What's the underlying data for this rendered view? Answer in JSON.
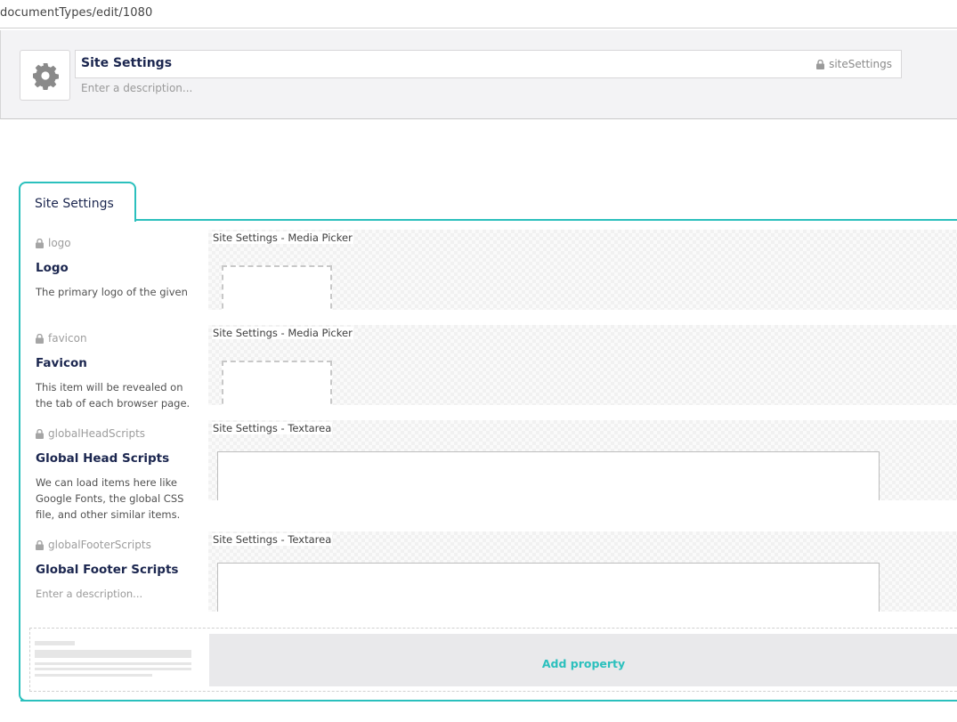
{
  "url": "documentTypes/edit/1080",
  "header": {
    "icon": "gear-icon",
    "name": "Site Settings",
    "alias": "siteSettings",
    "description_placeholder": "Enter a description..."
  },
  "group": {
    "tab_label": "Site Settings"
  },
  "properties": [
    {
      "alias": "logo",
      "label": "Logo",
      "description": "The primary logo of the given site.",
      "editor": "Site Settings - Media Picker",
      "editor_kind": "media"
    },
    {
      "alias": "favicon",
      "label": "Favicon",
      "description": "This item will be revealed on the tab of each browser page.",
      "editor": "Site Settings - Media Picker",
      "editor_kind": "media"
    },
    {
      "alias": "globalHeadScripts",
      "label": "Global Head Scripts",
      "description": "We can load items here like Google Fonts, the global CSS file, and other similar items.",
      "editor": "Site Settings - Textarea",
      "editor_kind": "textarea"
    },
    {
      "alias": "globalFooterScripts",
      "label": "Global Footer Scripts",
      "description": "Enter a description...",
      "description_is_placeholder": true,
      "editor": "Site Settings - Textarea",
      "editor_kind": "textarea"
    }
  ],
  "add_property_label": "Add property",
  "colors": {
    "accent": "#2bc0bd",
    "text": "#1b264f"
  }
}
